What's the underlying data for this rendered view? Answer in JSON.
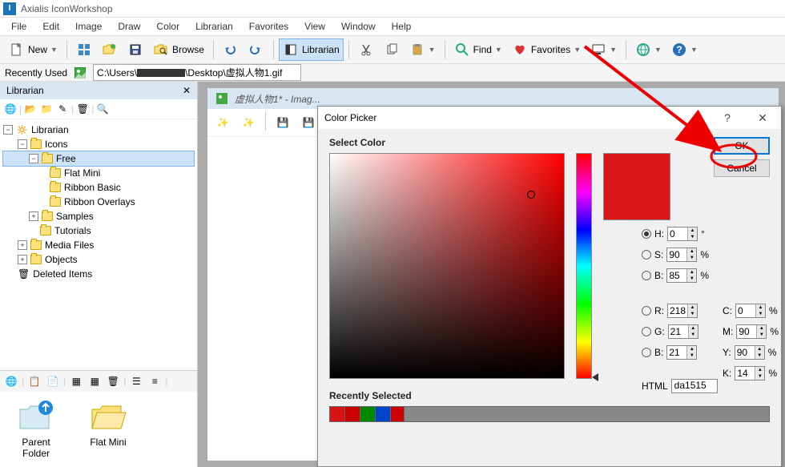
{
  "app": {
    "title": "Axialis IconWorkshop",
    "icon_letter": "I"
  },
  "menu": [
    "File",
    "Edit",
    "Image",
    "Draw",
    "Color",
    "Librarian",
    "Favorites",
    "View",
    "Window",
    "Help"
  ],
  "toolbar": {
    "new_label": "New",
    "browse_label": "Browse",
    "librarian_label": "Librarian",
    "find_label": "Find",
    "favorites_label": "Favorites"
  },
  "recent": {
    "label": "Recently Used",
    "path_prefix": "C:\\Users\\",
    "path_suffix": "\\Desktop\\虚拟人物1.gif"
  },
  "sidebar": {
    "title": "Librarian",
    "tree": {
      "root": "Librarian",
      "icons": "Icons",
      "free": "Free",
      "flat_mini": "Flat Mini",
      "ribbon_basic": "Ribbon Basic",
      "ribbon_overlays": "Ribbon Overlays",
      "samples": "Samples",
      "tutorials": "Tutorials",
      "media": "Media Files",
      "objects": "Objects",
      "deleted": "Deleted Items"
    },
    "folders": {
      "parent": "Parent Folder",
      "flat": "Flat Mini"
    }
  },
  "doc": {
    "title": "虚拟人物1* - Imag..."
  },
  "dialog": {
    "title": "Color Picker",
    "select_label": "Select Color",
    "ok": "OK",
    "cancel": "Cancel",
    "hsv": {
      "h_label": "H:",
      "s_label": "S:",
      "b_label": "B:",
      "h": "0",
      "s": "90",
      "b": "85",
      "deg": "°",
      "pct": "%"
    },
    "rgb": {
      "r_label": "R:",
      "g_label": "G:",
      "b_label": "B:",
      "r": "218",
      "g": "21",
      "b": "21"
    },
    "cmyk": {
      "c_label": "C:",
      "m_label": "M:",
      "y_label": "Y:",
      "k_label": "K:",
      "c": "0",
      "m": "90",
      "y": "90",
      "k": "14"
    },
    "html_label": "HTML",
    "html_val": "da1515",
    "recent_label": "Recently Selected",
    "swatches": [
      "#d81515",
      "#cc0000",
      "#008800",
      "#0044cc",
      "#cc0000"
    ],
    "preview_color": "#da1515"
  }
}
